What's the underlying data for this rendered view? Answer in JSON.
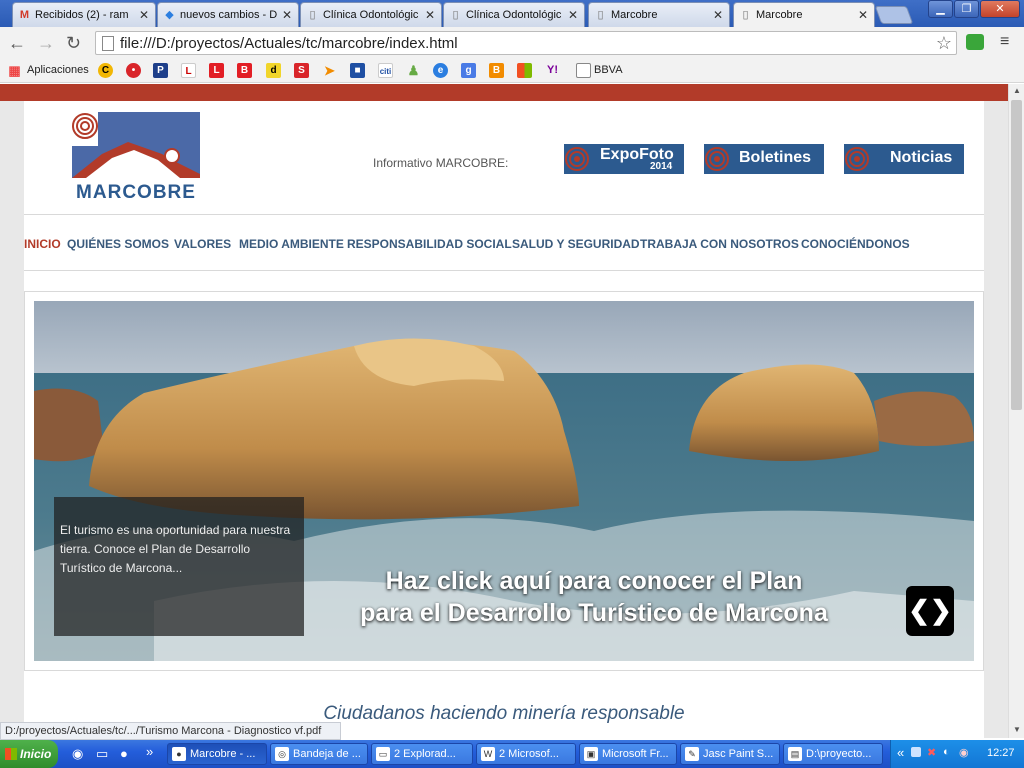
{
  "browser": {
    "tabs": [
      {
        "label": "Recibidos (2) - ram",
        "icon": "M",
        "icon_color": "#d23a2a"
      },
      {
        "label": "nuevos cambios - D",
        "icon": "◆",
        "icon_color": "#2b7ee0"
      },
      {
        "label": "Clínica Odontológic",
        "icon": "▯",
        "icon_color": "#777777"
      },
      {
        "label": "Clínica Odontológic",
        "icon": "▯",
        "icon_color": "#777777"
      },
      {
        "label": "Marcobre",
        "icon": "▯",
        "icon_color": "#777777"
      },
      {
        "label": "Marcobre",
        "icon": "▯",
        "icon_color": "#777777"
      }
    ],
    "url": "file:///D:/proyectos/Actuales/tc/marcobre/index.html",
    "bookmarks": {
      "apps_label": "Aplicaciones",
      "last_label": "BBVA"
    },
    "status_url": "D:/proyectos/Actuales/tc/.../Turismo Marcona - Diagnostico vf.pdf"
  },
  "site": {
    "logo_text": "MARCOBRE",
    "informativo_label": "Informativo MARCOBRE:",
    "badges": [
      {
        "label": "ExpoFoto",
        "sub": "2014"
      },
      {
        "label": "Boletines",
        "sub": ""
      },
      {
        "label": "Noticias",
        "sub": ""
      }
    ],
    "menu": [
      "INICIO",
      "QUIÉNES SOMOS",
      "VALORES",
      "MEDIO AMBIENTE",
      "RESPONSABILIDAD SOCIAL",
      "SALUD Y SEGURIDAD",
      "TRABAJA CON NOSOTROS",
      "CONOCIÉNDONOS"
    ],
    "slide": {
      "caption": "El turismo es una oportunidad para nuestra tierra. Conoce el Plan de Desarrollo Turístico de Marcona...",
      "headline_1": "Haz click aquí para conocer el Plan",
      "headline_2": "para el Desarrollo Turístico de Marcona"
    },
    "tagline": "Ciudadanos haciendo minería responsable"
  },
  "taskbar": {
    "start_label": "Inicio",
    "tasks": [
      {
        "label": "Marcobre - ...",
        "icon": "●"
      },
      {
        "label": "Bandeja de ...",
        "icon": "◎"
      },
      {
        "label": "2 Explorad...",
        "icon": "▭"
      },
      {
        "label": "2 Microsof...",
        "icon": "W"
      },
      {
        "label": "Microsoft Fr...",
        "icon": "▣"
      },
      {
        "label": "Jasc Paint S...",
        "icon": "✎"
      },
      {
        "label": "D:\\proyecto...",
        "icon": "▤"
      }
    ],
    "clock": "12:27"
  },
  "colors": {
    "brand_red": "#b23b29",
    "brand_blue": "#2c5a8f",
    "menu_blue": "#3a5a7c"
  }
}
